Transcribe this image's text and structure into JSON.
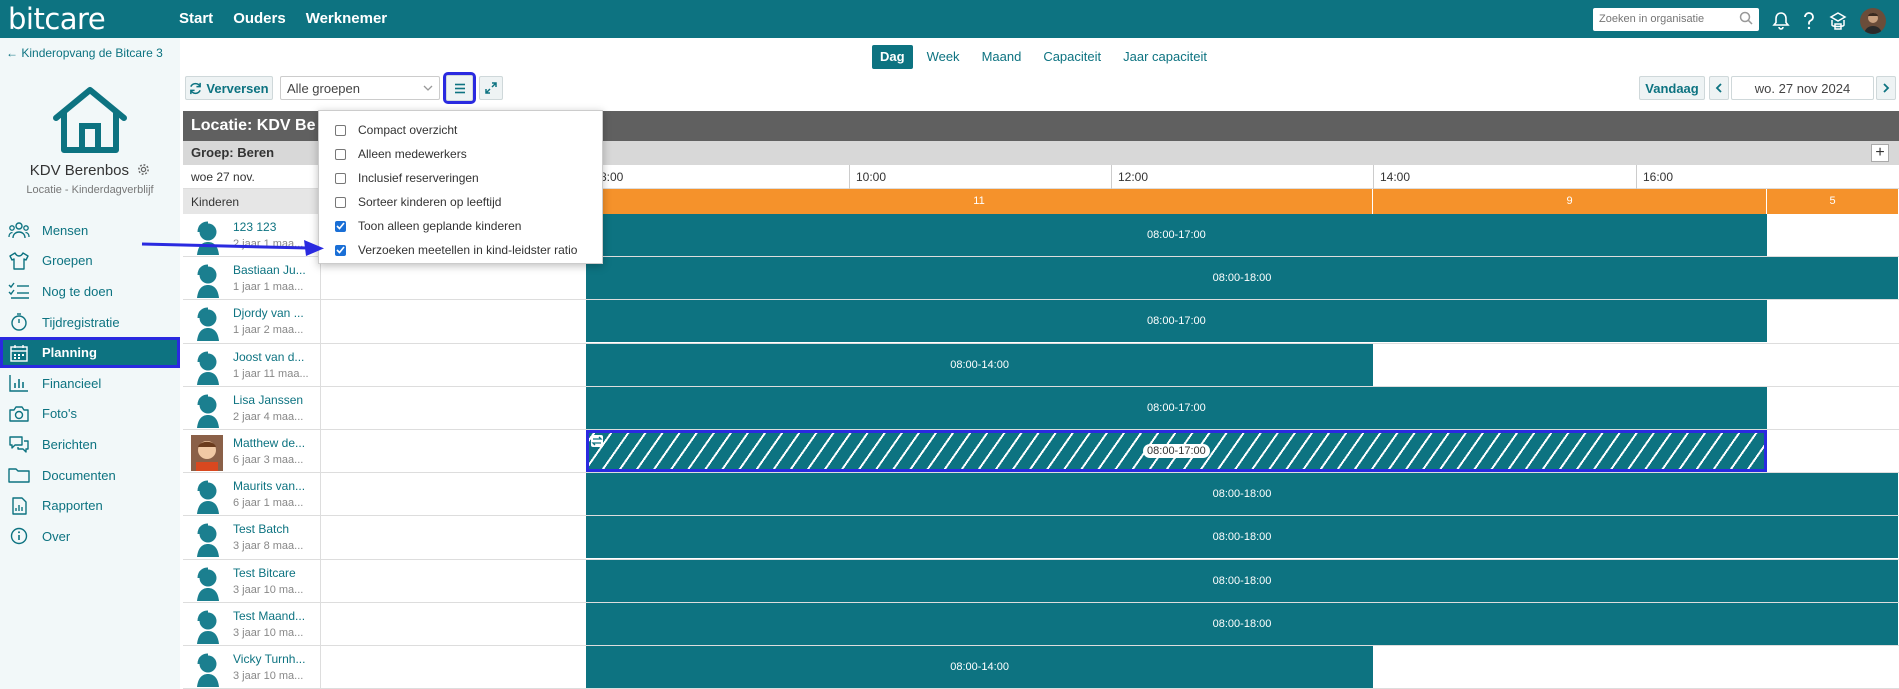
{
  "header": {
    "logo": "bitcare",
    "nav": [
      "Start",
      "Ouders",
      "Werknemer"
    ],
    "search_placeholder": "Zoeken in organisatie"
  },
  "sidebar": {
    "back_link": "Kinderopvang de Bitcare 3",
    "location_name": "KDV Berenbos",
    "location_sub": "Locatie - Kinderdagverblijf",
    "items": [
      {
        "label": "Mensen",
        "icon": "people-icon"
      },
      {
        "label": "Groepen",
        "icon": "shirt-icon"
      },
      {
        "label": "Nog te doen",
        "icon": "checklist-icon"
      },
      {
        "label": "Tijdregistratie",
        "icon": "stopwatch-icon"
      },
      {
        "label": "Planning",
        "icon": "calendar-icon",
        "active": true
      },
      {
        "label": "Financieel",
        "icon": "chart-icon"
      },
      {
        "label": "Foto's",
        "icon": "camera-icon"
      },
      {
        "label": "Berichten",
        "icon": "messages-icon"
      },
      {
        "label": "Documenten",
        "icon": "folder-icon"
      },
      {
        "label": "Rapporten",
        "icon": "report-icon"
      },
      {
        "label": "Over",
        "icon": "info-icon"
      }
    ]
  },
  "view_tabs": [
    {
      "label": "Dag",
      "active": true
    },
    {
      "label": "Week"
    },
    {
      "label": "Maand"
    },
    {
      "label": "Capaciteit"
    },
    {
      "label": "Jaar capaciteit"
    }
  ],
  "toolbar": {
    "refresh_label": "Verversen",
    "group_select": "Alle groepen",
    "today_label": "Vandaag",
    "date_label": "wo. 27 nov 2024"
  },
  "planning": {
    "location_header": "Locatie: KDV Be",
    "group_header": "Groep: Beren",
    "date_short": "woe 27 nov.",
    "hours": [
      "8:00",
      "10:00",
      "12:00",
      "14:00",
      "16:00"
    ],
    "kids_header": "Kinderen",
    "ratios": [
      "11",
      "9",
      "5"
    ],
    "rows": [
      {
        "name": "123 123",
        "age": "2 jaar 1 maa...",
        "time": "08:00-17:00",
        "end": 17
      },
      {
        "name": "Bastiaan Ju...",
        "age": "1 jaar 1 maa...",
        "time": "08:00-18:00",
        "end": 18
      },
      {
        "name": "Djordy van ...",
        "age": "1 jaar 2 maa...",
        "time": "08:00-17:00",
        "end": 17
      },
      {
        "name": "Joost van d...",
        "age": "1 jaar 11 maa...",
        "time": "08:00-14:00",
        "end": 14
      },
      {
        "name": "Lisa Janssen",
        "age": "2 jaar 4 maa...",
        "time": "08:00-17:00",
        "end": 17
      },
      {
        "name": "Matthew de...",
        "age": "6 jaar 3 maa...",
        "time": "08:00-17:00",
        "end": 17,
        "request": true,
        "photo": true
      },
      {
        "name": "Maurits van...",
        "age": "6 jaar 1 maa...",
        "time": "08:00-18:00",
        "end": 18
      },
      {
        "name": "Test Batch",
        "age": "3 jaar 8 maa...",
        "time": "08:00-18:00",
        "end": 18
      },
      {
        "name": "Test Bitcare",
        "age": "3 jaar 10 ma...",
        "time": "08:00-18:00",
        "end": 18
      },
      {
        "name": "Test Maand...",
        "age": "3 jaar 10 ma...",
        "time": "08:00-18:00",
        "end": 18
      },
      {
        "name": "Vicky Turnh...",
        "age": "3 jaar 10 ma...",
        "time": "08:00-14:00",
        "end": 14
      }
    ]
  },
  "dropdown": {
    "options": [
      {
        "label": "Compact overzicht",
        "checked": false
      },
      {
        "label": "Alleen medewerkers",
        "checked": false
      },
      {
        "label": "Inclusief reserveringen",
        "checked": false
      },
      {
        "label": "Sorteer kinderen op leeftijd",
        "checked": false
      },
      {
        "label": "Toon alleen geplande kinderen",
        "checked": true
      },
      {
        "label": "Verzoeken meetellen in kind-leidster ratio",
        "checked": true
      }
    ]
  },
  "colors": {
    "brand": "#0d7381",
    "ratio": "#f5922b",
    "highlight": "#2a2ae0"
  }
}
